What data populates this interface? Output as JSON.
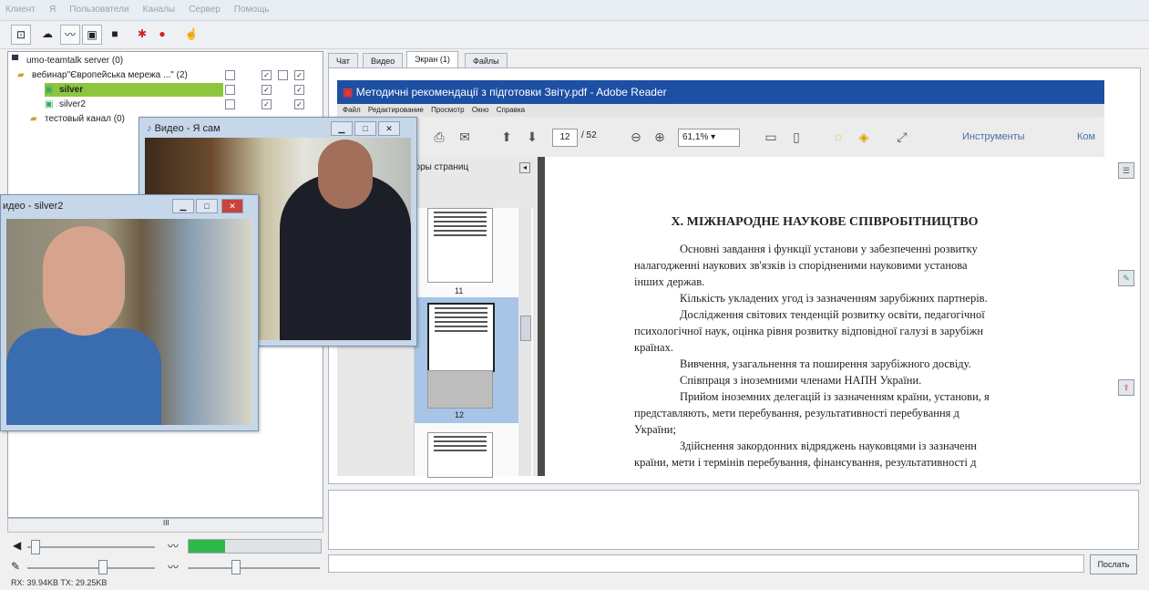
{
  "menu": [
    "Клиент",
    "Я",
    "Пользователи",
    "Каналы",
    "Сервер",
    "Помощь"
  ],
  "tree": {
    "server": "umo-teamtalk server (0)",
    "channel1": "вебинар\"Європейська мережа ...\" (2)",
    "user1": "silver",
    "user2": "silver2",
    "channel2": "тестовый канал (0)"
  },
  "tabs": [
    "Чат",
    "Видео",
    "Экран (1)",
    "Файлы"
  ],
  "video_self": {
    "title": "Видео - Я сам"
  },
  "video_other": {
    "title": "идео - silver2"
  },
  "adobe": {
    "title": "Методичні рекомендації з підготовки Звіту.pdf - Adobe Reader",
    "menu": [
      "Файл",
      "Редактирование",
      "Просмотр",
      "Окно",
      "Справка"
    ],
    "page_current": "12",
    "page_total": "/ 52",
    "zoom": "61,1%",
    "tools_label": "Инструменты",
    "comment_label": "Ком",
    "thumbs_header": "ооры страниц",
    "thumb_labels": [
      "11",
      "12"
    ]
  },
  "doc": {
    "heading": "Х. МІЖНАРОДНЕ НАУКОВЕ СПІВРОБІТНИЦТВО",
    "lines": [
      "Основні завдання і функції установи у забезпеченні розвитку",
      "налагодженні наукових зв'язків із спорідненими науковими установа",
      "інших держав.",
      "Кількість укладених угод із зазначенням зарубіжних партнерів.",
      "Дослідження світових тенденцій розвитку освіти, педагогічної",
      "психологічної наук, оцінка рівня розвитку відповідної галузі в зарубіжн",
      "країнах.",
      "Вивчення, узагальнення та поширення зарубіжного досвіду.",
      "Співпраця з іноземними членами НАПН України.",
      "Прийом іноземних делегацій із зазначенням країни, установи, я",
      "представляють, мети перебування, результативності перебування д",
      "України;",
      "Здійснення закордонних відряджень науковцями із зазначенн",
      "країни, мети і термінів перебування, фінансування, результативності д"
    ]
  },
  "send_label": "Послать",
  "status": "RX: 39.94KB TX: 29.25KB",
  "scroll_marker": "III"
}
